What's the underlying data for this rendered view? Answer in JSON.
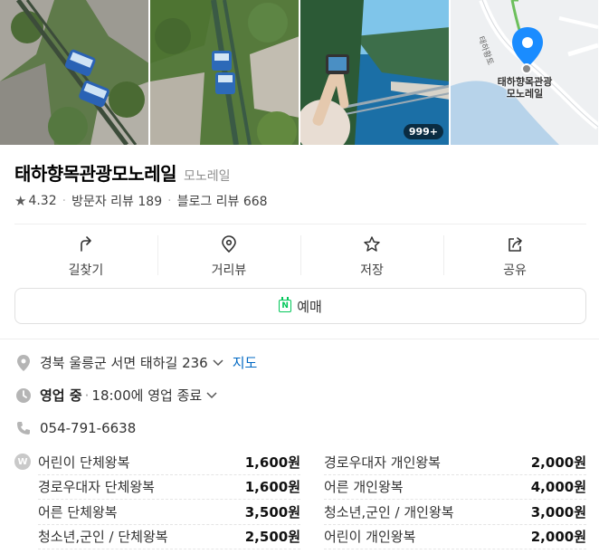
{
  "photos": {
    "more_count": "999+",
    "map_label_line1": "태하향목관광",
    "map_label_line2": "모노레일",
    "map_road_label": "태하황토"
  },
  "place": {
    "title": "태하향목관광모노레일",
    "category": "모노레일",
    "rating": "4.32",
    "visitor_reviews": "방문자 리뷰 189",
    "blog_reviews": "블로그 리뷰 668"
  },
  "actions": [
    {
      "label": "길찾기",
      "icon": "directions-icon"
    },
    {
      "label": "거리뷰",
      "icon": "location-pin-icon"
    },
    {
      "label": "저장",
      "icon": "star-icon"
    },
    {
      "label": "공유",
      "icon": "share-icon"
    }
  ],
  "reserve": {
    "label": "예매",
    "badge": "N"
  },
  "info": {
    "address": "경북 울릉군 서면 태하길 236",
    "map_link": "지도",
    "status": "영업 중",
    "hours": "18:00에 영업 종료",
    "phone": "054-791-6638"
  },
  "prices": [
    {
      "name": "어린이 단체왕복",
      "value": "1,600원"
    },
    {
      "name": "경로우대자 개인왕복",
      "value": "2,000원"
    },
    {
      "name": "경로우대자 단체왕복",
      "value": "1,600원"
    },
    {
      "name": "어른 개인왕복",
      "value": "4,000원"
    },
    {
      "name": "어른 단체왕복",
      "value": "3,500원"
    },
    {
      "name": "청소년,군인 / 개인왕복",
      "value": "3,000원"
    },
    {
      "name": "청소년,군인 / 단체왕복",
      "value": "2,500원"
    },
    {
      "name": "어린이 개인왕복",
      "value": "2,000원"
    }
  ],
  "colors": {
    "accent": "#0068c3",
    "pin": "#1a8cff",
    "naver_green": "#03c75a"
  }
}
